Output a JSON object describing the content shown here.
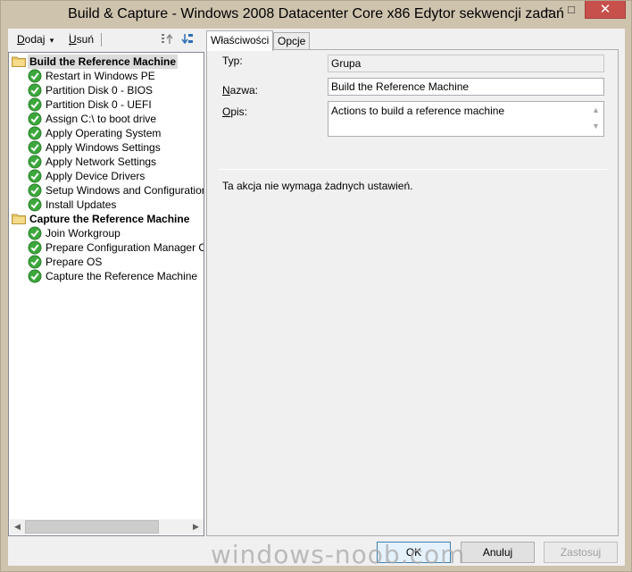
{
  "window": {
    "title": "Build & Capture - Windows 2008 Datacenter Core x86 Edytor sekwencji zadań",
    "close_glyph": "✕",
    "minimize_glyph": "–",
    "maximize_glyph": "□"
  },
  "toolbar": {
    "add": {
      "first": "D",
      "rest": "odaj",
      "arrow": "▾"
    },
    "remove": {
      "first": "U",
      "rest": "suń"
    },
    "icons": [
      "move-up-icon",
      "move-down-icon"
    ]
  },
  "tree": {
    "items": [
      {
        "label": "Build the Reference Machine",
        "type": "group",
        "selected": true
      },
      {
        "label": "Restart in Windows PE",
        "type": "step"
      },
      {
        "label": "Partition Disk 0 - BIOS",
        "type": "step"
      },
      {
        "label": "Partition Disk 0 - UEFI",
        "type": "step"
      },
      {
        "label": "Assign C:\\ to boot drive",
        "type": "step"
      },
      {
        "label": "Apply Operating System",
        "type": "step"
      },
      {
        "label": "Apply Windows Settings",
        "type": "step"
      },
      {
        "label": "Apply Network Settings",
        "type": "step"
      },
      {
        "label": "Apply Device Drivers",
        "type": "step"
      },
      {
        "label": "Setup Windows and Configuration",
        "type": "step"
      },
      {
        "label": "Install Updates",
        "type": "step"
      },
      {
        "label": "Capture the Reference Machine",
        "type": "group"
      },
      {
        "label": "Join Workgroup",
        "type": "step"
      },
      {
        "label": "Prepare Configuration Manager Cli",
        "type": "step"
      },
      {
        "label": "Prepare OS",
        "type": "step"
      },
      {
        "label": "Capture the Reference Machine",
        "type": "step"
      }
    ],
    "scroll_left": "◀",
    "scroll_right": "▶"
  },
  "tabs": [
    {
      "label": "Właściwości",
      "active": true
    },
    {
      "label": "Opcje",
      "active": false
    }
  ],
  "properties": {
    "type_label": "Typ:",
    "type_value": "Grupa",
    "name_label": {
      "first": "N",
      "rest": "azwa:"
    },
    "name_value": "Build the Reference Machine",
    "desc_label": {
      "first": "O",
      "rest": "pis:"
    },
    "desc_value": "Actions to build a reference machine",
    "scroll_up": "▲",
    "scroll_down": "▼",
    "info": "Ta akcja nie wymaga żadnych ustawień."
  },
  "buttons": {
    "ok": "OK",
    "cancel": "Anuluj",
    "apply": "Zastosuj"
  },
  "watermark": "windows-noob.com",
  "colors": {
    "title_bar": "#cec3ad",
    "close_button": "#c7504b",
    "check_green": "#3ca83c",
    "folder_yellow": "#e8c766"
  }
}
